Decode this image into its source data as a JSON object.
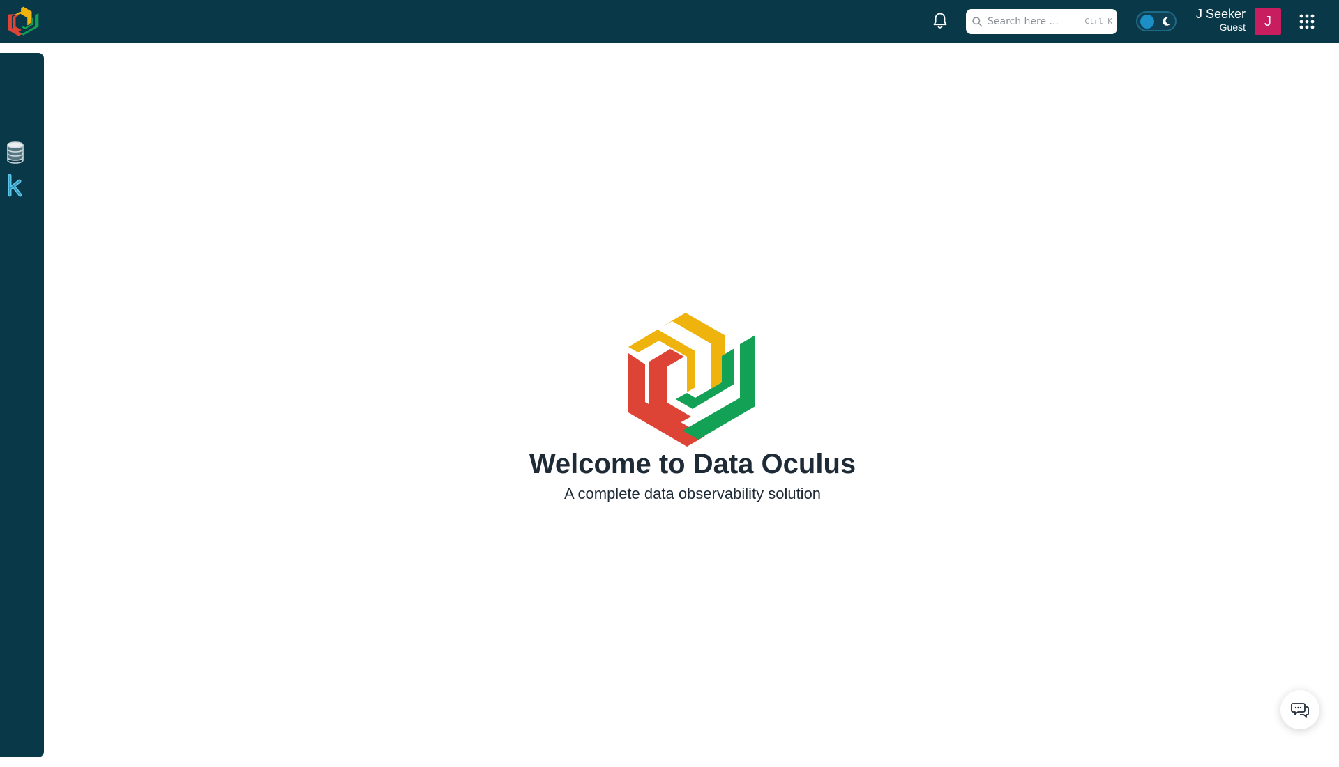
{
  "header": {
    "logo_icon": "data-oculus-logo-icon",
    "notifications_icon": "bell-icon",
    "search": {
      "placeholder": "Search here ...",
      "shortcut": "Ctrl K",
      "icon": "search-icon"
    },
    "theme_toggle": {
      "icon": "moon-icon",
      "knob_color": "#1b8fc6"
    },
    "user": {
      "name": "J Seeker",
      "role": "Guest",
      "avatar_initial": "J",
      "avatar_color": "#c81d5e"
    },
    "apps_icon": "grid-icon"
  },
  "sidebar": {
    "items": [
      {
        "icon": "database-icon"
      },
      {
        "icon": "k-icon"
      }
    ]
  },
  "main": {
    "logo_icon": "data-oculus-logo-icon",
    "title": "Welcome to Data Oculus",
    "subtitle": "A complete data observability solution"
  },
  "chat_button": {
    "icon": "chat-icon"
  },
  "colors": {
    "header_bg": "#093848",
    "logo_yellow": "#eeb40d",
    "logo_green": "#13a156",
    "logo_red": "#dd4436"
  }
}
